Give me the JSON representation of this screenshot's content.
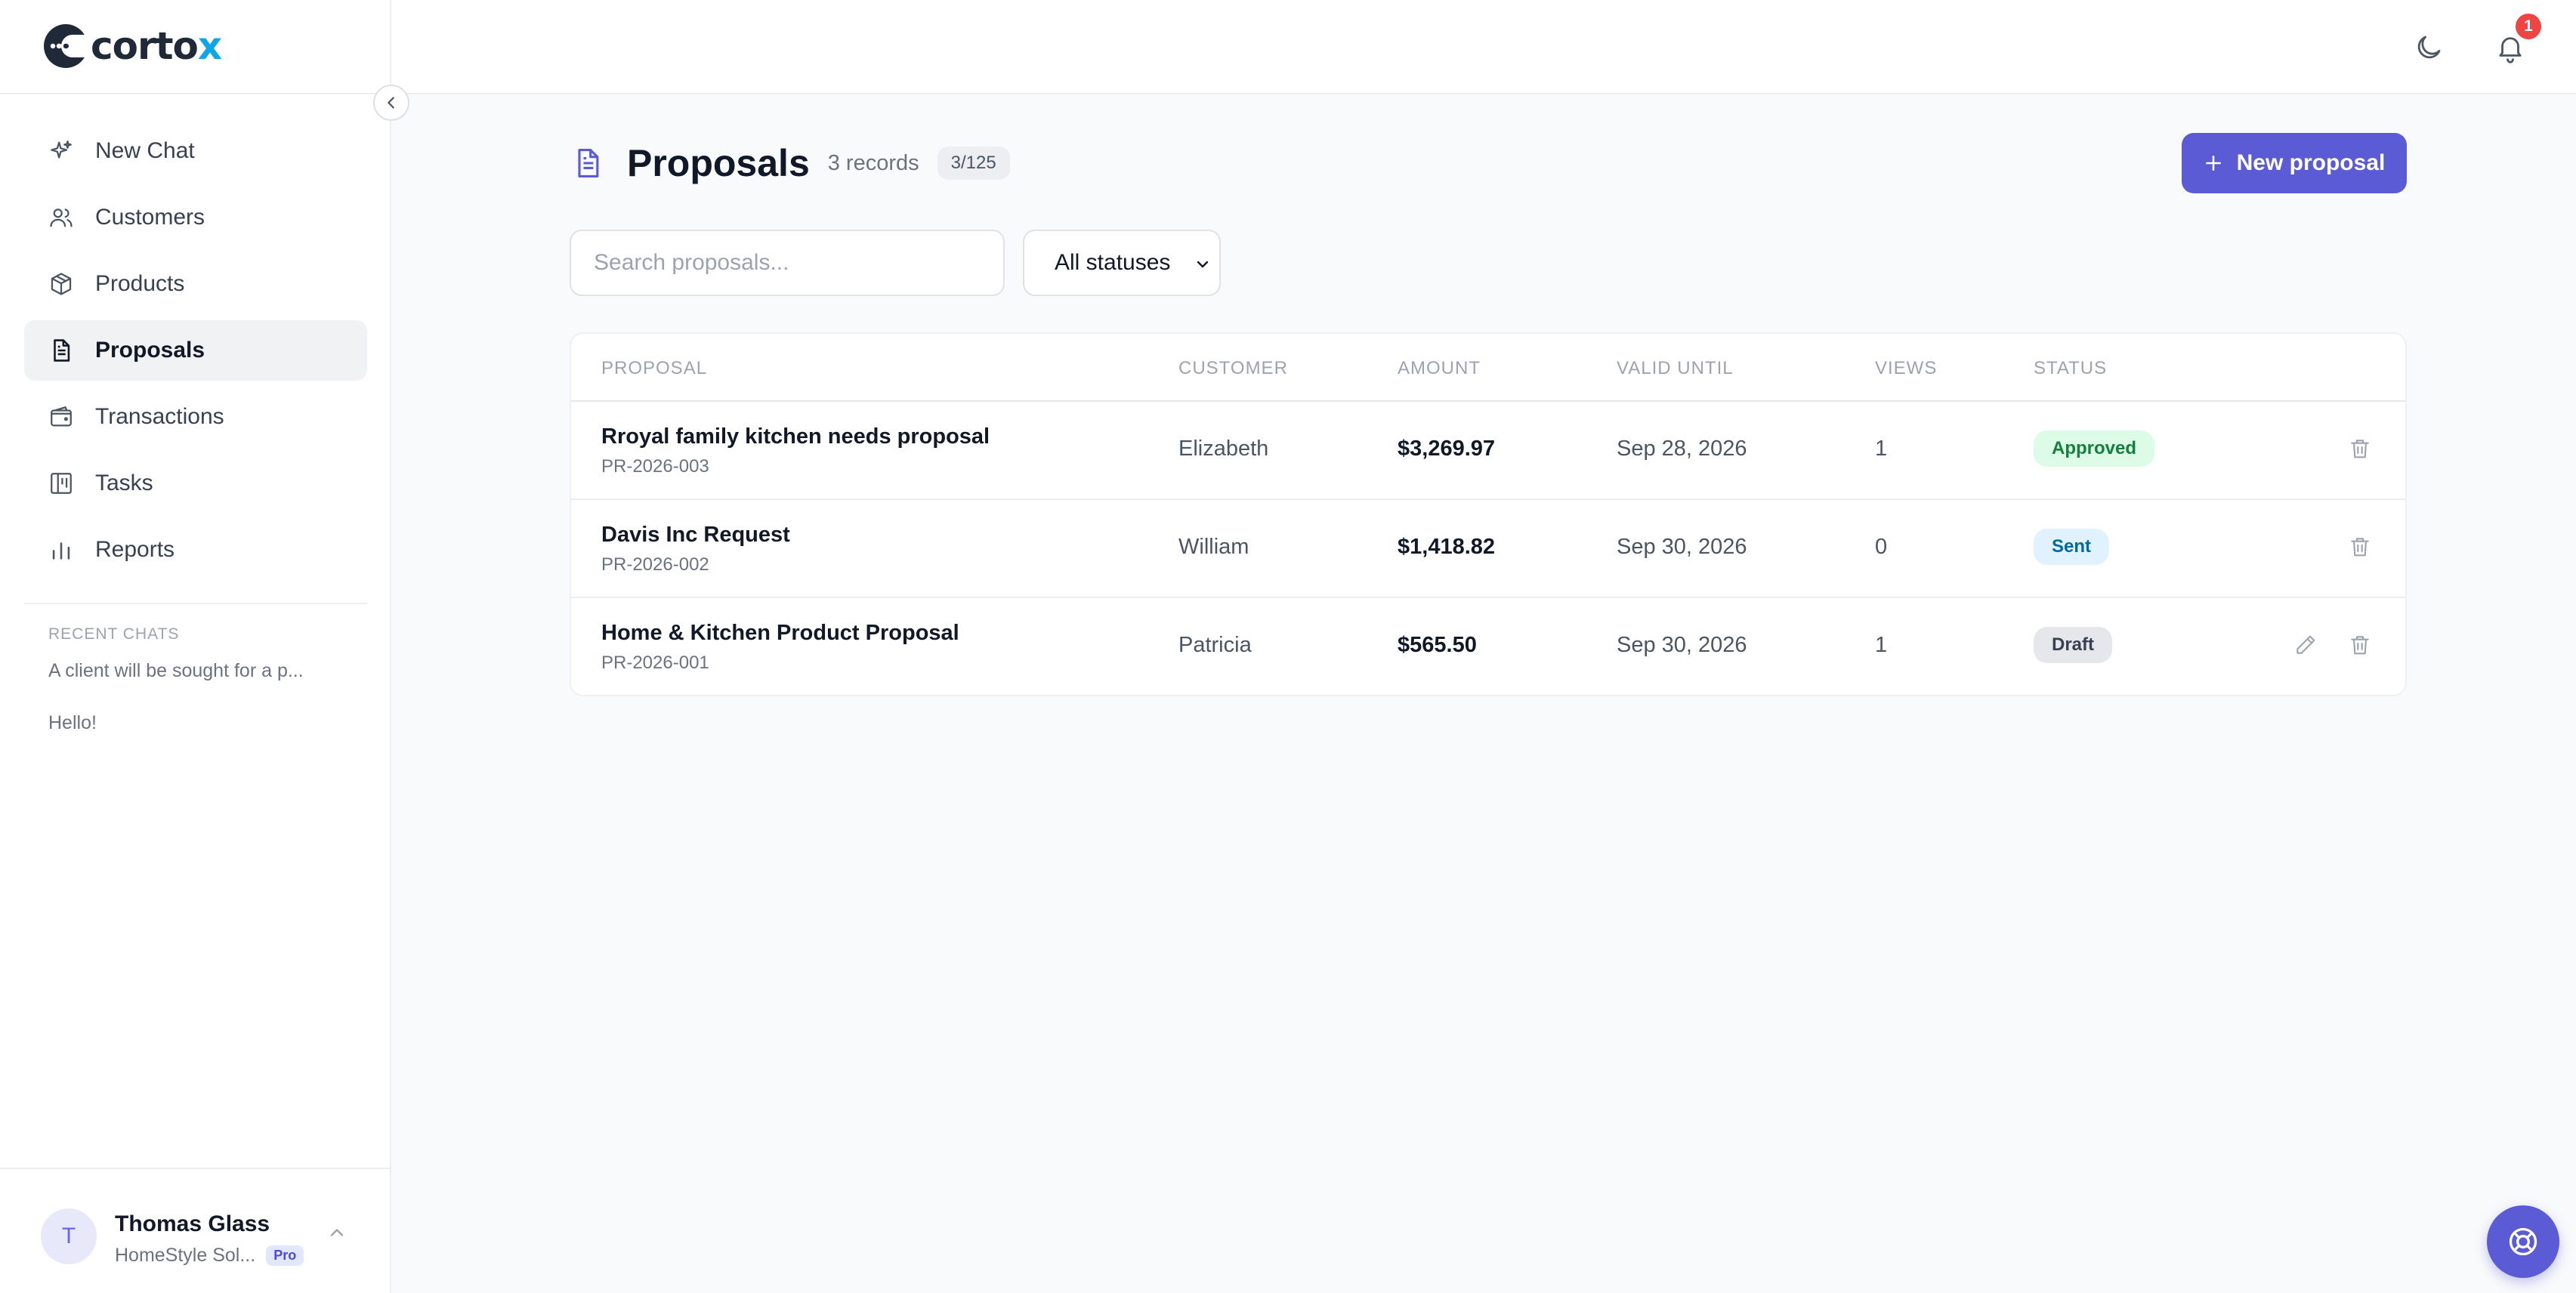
{
  "app": {
    "logo_text_main": "corto",
    "logo_text_accent": "x"
  },
  "sidebar": {
    "items": [
      {
        "label": "New Chat",
        "icon": "sparkles-icon",
        "active": false
      },
      {
        "label": "Customers",
        "icon": "users-icon",
        "active": false
      },
      {
        "label": "Products",
        "icon": "package-icon",
        "active": false
      },
      {
        "label": "Proposals",
        "icon": "document-icon",
        "active": true
      },
      {
        "label": "Transactions",
        "icon": "wallet-icon",
        "active": false
      },
      {
        "label": "Tasks",
        "icon": "kanban-icon",
        "active": false
      },
      {
        "label": "Reports",
        "icon": "bar-chart-icon",
        "active": false
      }
    ],
    "recent_title": "RECENT CHATS",
    "recent_chats": [
      "A client will be sought for a p...",
      "Hello!"
    ],
    "user": {
      "initial": "T",
      "name": "Thomas Glass",
      "company": "HomeStyle Sol...",
      "plan": "Pro"
    }
  },
  "topbar": {
    "notification_count": "1"
  },
  "page": {
    "title": "Proposals",
    "records": "3 records",
    "count": "3/125",
    "new_button": "New proposal",
    "search_placeholder": "Search proposals...",
    "status_filter": "All statuses"
  },
  "table": {
    "headers": {
      "proposal": "PROPOSAL",
      "customer": "CUSTOMER",
      "amount": "AMOUNT",
      "valid_until": "VALID UNTIL",
      "views": "VIEWS",
      "status": "STATUS"
    },
    "rows": [
      {
        "title": "Rroyal family kitchen needs proposal",
        "code": "PR-2026-003",
        "customer": "Elizabeth",
        "amount": "$3,269.97",
        "valid_until": "Sep 28, 2026",
        "views": "1",
        "status": "Approved",
        "editable": false
      },
      {
        "title": "Davis Inc Request",
        "code": "PR-2026-002",
        "customer": "William",
        "amount": "$1,418.82",
        "valid_until": "Sep 30, 2026",
        "views": "0",
        "status": "Sent",
        "editable": false
      },
      {
        "title": "Home & Kitchen Product Proposal",
        "code": "PR-2026-001",
        "customer": "Patricia",
        "amount": "$565.50",
        "valid_until": "Sep 30, 2026",
        "views": "1",
        "status": "Draft",
        "editable": true
      }
    ]
  },
  "colors": {
    "accent": "#5b5bd6",
    "approved_bg": "#dcfce7",
    "sent_bg": "#e0f2fe",
    "draft_bg": "#e5e7eb",
    "notification": "#ef4444"
  }
}
